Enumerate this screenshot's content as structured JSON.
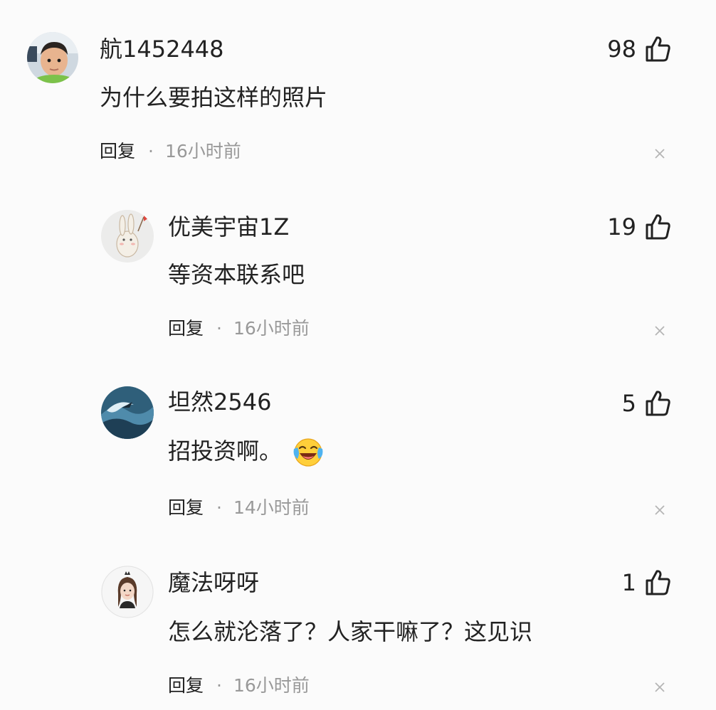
{
  "comments": [
    {
      "username": "航1452448",
      "text": "为什么要拍这样的照片",
      "likes": "98",
      "reply_label": "回复",
      "separator": "·",
      "time": "16小时前"
    },
    {
      "username": "优美宇宙1Z",
      "text": "等资本联系吧",
      "likes": "19",
      "reply_label": "回复",
      "separator": "·",
      "time": "16小时前"
    },
    {
      "username": "坦然2546",
      "text": "招投资啊。",
      "emoji": "crying-laughing-emoji",
      "likes": "5",
      "reply_label": "回复",
      "separator": "·",
      "time": "14小时前"
    },
    {
      "username": "魔法呀呀",
      "text": "怎么就沦落了？人家干嘛了？这见识",
      "likes": "1",
      "reply_label": "回复",
      "separator": "·",
      "time": "16小时前"
    }
  ],
  "icons": {
    "like": "thumbs-up-icon",
    "dismiss": "close-icon"
  },
  "colors": {
    "background": "#fbfbfb",
    "primary_text": "#222222",
    "secondary_text": "#999999"
  }
}
